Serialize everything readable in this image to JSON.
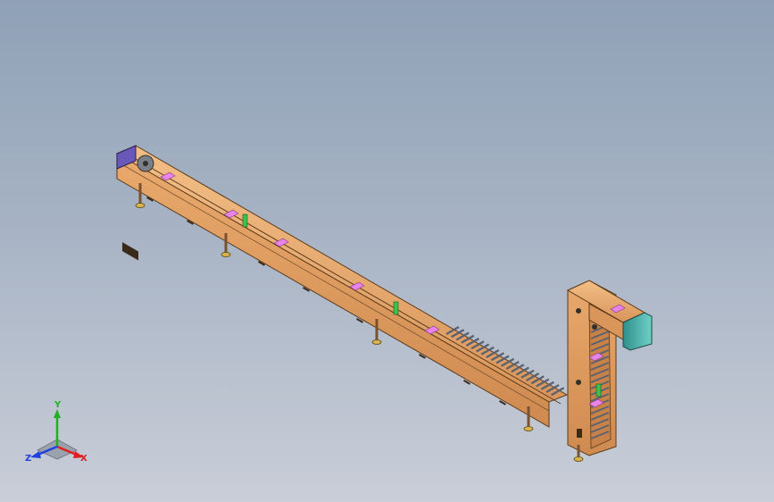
{
  "window": {
    "title": ""
  },
  "model": {
    "name": "",
    "frame_color": "#e8a86a",
    "frame_edge_color": "#5a3a1a",
    "roller_color": "#6f7785",
    "marker_color": "#e884e8",
    "sensor_color": "#3cc24a",
    "motor_color": "#3fa8a0",
    "end_cap_color": "#6a58b8"
  },
  "triad": {
    "x_label": "X",
    "y_label": "Y",
    "z_label": "Z",
    "x_color": "#e02020",
    "y_color": "#20b020",
    "z_color": "#2040e0"
  }
}
